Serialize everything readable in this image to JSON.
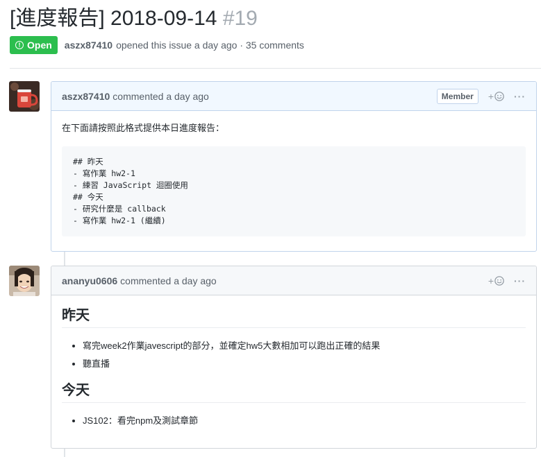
{
  "issue": {
    "title": "[進度報告] 2018-09-14",
    "number": "#19",
    "state": "Open",
    "author": "aszx87410",
    "meta_text": "opened this issue a day ago · 35 comments"
  },
  "comments": [
    {
      "author": "aszx87410",
      "time_text": "commented a day ago",
      "badge": "Member",
      "body_text": "在下面請按照此格式提供本日進度報告：",
      "code_lines": "## 昨天\n- 寫作業 hw2-1\n- 練習 JavaScript 迴圈使用\n## 今天\n- 研究什麼是 callback\n- 寫作業 hw2-1 (繼續)"
    },
    {
      "author": "ananyu0606",
      "time_text": "commented a day ago",
      "sections": [
        {
          "heading": "昨天",
          "items": [
            "寫完week2作業javescript的部分，並確定hw5大數相加可以跑出正確的結果",
            "聽直播"
          ]
        },
        {
          "heading": "今天",
          "items": [
            "JS102：看完npm及測試章節"
          ]
        }
      ]
    }
  ],
  "icons": {
    "reaction": "smiley-icon",
    "more": "kebab-horizontal-icon",
    "state": "issue-opened-icon"
  },
  "colors": {
    "open_green": "#2cbe4e",
    "owner_header_bg": "#f1f8ff",
    "border": "#d1d5da"
  }
}
